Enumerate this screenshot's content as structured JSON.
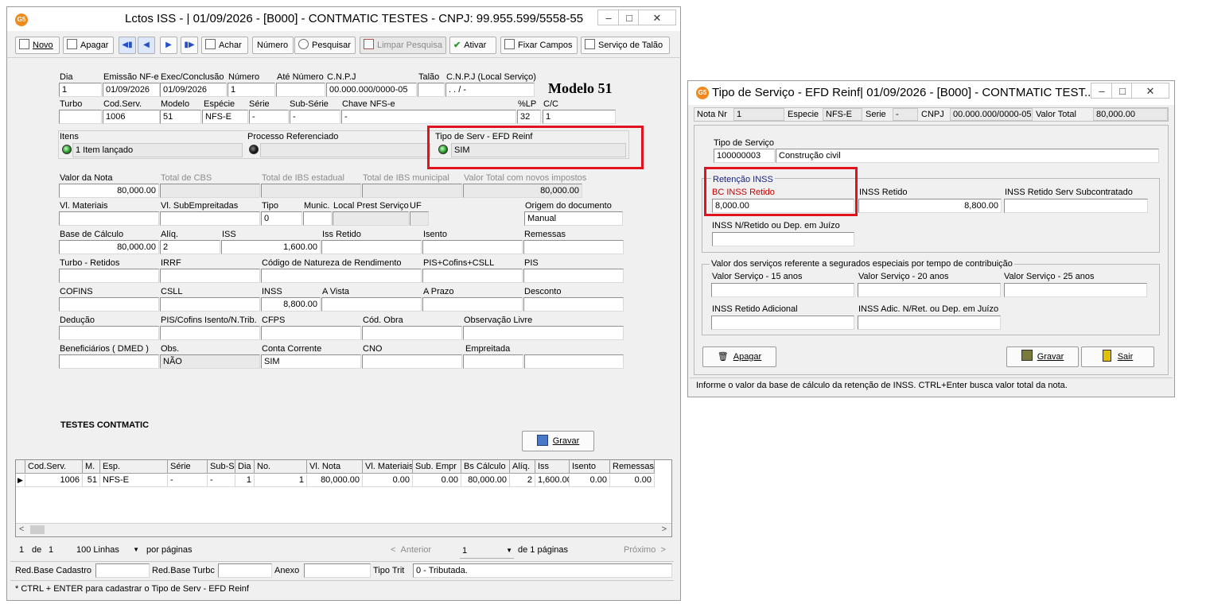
{
  "main": {
    "title": "Lctos ISS - |  01/09/2026 - [B000] - CONTMATIC  TESTES - CNPJ: 99.955.599/5558-55",
    "app_icon": "G5",
    "toolbar": {
      "novo": "Novo",
      "apagar": "Apagar",
      "achar": "Achar",
      "numero": "Número",
      "pesquisar": "Pesquisar",
      "limpar": "Limpar Pesquisa",
      "ativar": "Ativar",
      "fixar": "Fixar Campos",
      "servico": "Serviço de Talão"
    },
    "modelo": "Modelo 51",
    "labels": {
      "dia": "Dia",
      "emissao": "Emissão NF-e",
      "exec": "Exec/Conclusão",
      "numero": "Número",
      "ate_numero": "Até Número",
      "cnpj": "C.N.P.J",
      "talao": "Talão",
      "cnpj_local": "C.N.P.J (Local Serviço)",
      "turbo": "Turbo",
      "cod_serv": "Cod.Serv.",
      "modelo": "Modelo",
      "especie": "Espécie",
      "serie": "Série",
      "sub_serie": "Sub-Série",
      "chave": "Chave NFS-e",
      "lp": "%LP",
      "cc": "C/C",
      "itens": "Itens",
      "processo": "Processo Referenciado",
      "tipo_serv": "Tipo de Serv - EFD Reinf",
      "valor_nota": "Valor da Nota",
      "total_cbs": "Total de CBS",
      "total_ibs_est": "Total de IBS estadual",
      "total_ibs_mun": "Total de IBS municipal",
      "valor_total_novos": "Valor Total com novos impostos",
      "vl_materiais": "Vl. Materiais",
      "vl_sub": "Vl. SubEmpreitadas",
      "tipo": "Tipo",
      "munic": "Munic.",
      "local_prest": "Local Prest Serviço",
      "uf": "UF",
      "origem": "Origem do documento",
      "base_calc": "Base de Cálculo",
      "aliq": "Alíq.",
      "iss": "ISS",
      "iss_retido": "Iss Retido",
      "isento": "Isento",
      "remessas": "Remessas",
      "turbo_ret": "Turbo - Retidos",
      "irrf": "IRRF",
      "cod_nat": "Código de Natureza de Rendimento",
      "pis_cofins_csll": "PIS+Cofins+CSLL",
      "pis": "PIS",
      "cofins": "COFINS",
      "csll": "CSLL",
      "inss": "INSS",
      "a_vista": "A Vista",
      "a_prazo": "A Prazo",
      "desconto": "Desconto",
      "deducao": "Dedução",
      "pis_cofins_isento": "PIS/Cofins Isento/N.Trib.",
      "cfps": "CFPS",
      "cod_obra": "Cód. Obra",
      "obs_livre": "Observação Livre",
      "beneficiarios": "Beneficiários ( DMED )",
      "obs": "Obs.",
      "conta_corrente": "Conta Corrente",
      "cno": "CNO",
      "empreitada": "Empreitada"
    },
    "values": {
      "dia": "1",
      "emissao": "01/09/2026",
      "exec": "01/09/2026",
      "numero": "1",
      "cnpj": "00.000.000/0000-05",
      "cnpj_local": ".   .   /   -",
      "cod_serv": "1006",
      "modelo": "51",
      "especie": "NFS-E",
      "serie": "-",
      "sub_serie": "-",
      "chave": "-",
      "lp": "32",
      "cc": "1",
      "itens": "1 Item lançado",
      "tipo_serv": "SIM",
      "valor_nota": "80,000.00",
      "valor_total_novos": "80,000.00",
      "tipo": "0",
      "origem": "Manual",
      "base_calc": "80,000.00",
      "aliq": "2",
      "iss": "1,600.00",
      "inss": "8,800.00",
      "obs": "NÃO",
      "conta_corrente": "SIM"
    },
    "company": "TESTES CONTMATIC",
    "gravar": "Gravar",
    "grid": {
      "headers": [
        "Cod.Serv.",
        "M.",
        "Esp.",
        "Série",
        "Sub-S",
        "Dia",
        "No.",
        "Vl. Nota",
        "Vl. Materiais",
        "Sub. Empr",
        "Bs Cálculo",
        "Alíq.",
        "Iss",
        "Isento",
        "Remessas"
      ],
      "row": [
        "1006",
        "51",
        "NFS-E",
        "-",
        "-",
        "1",
        "1",
        "80,000.00",
        "0.00",
        "0.00",
        "80,000.00",
        "2",
        "1,600.00",
        "0.00",
        "0.00"
      ]
    },
    "pager": {
      "page": "1",
      "de": "de",
      "total": "1",
      "per_page": "100 Linhas",
      "por_paginas": "por páginas",
      "anterior": "Anterior",
      "current": "1",
      "de_paginas": "de 1 páginas",
      "proximo": "Próximo"
    },
    "bottom": {
      "red_base_cad": "Red.Base Cadastro",
      "red_base_turbo": "Red.Base Turbc",
      "anexo": "Anexo",
      "tipo_trib": "Tipo Trit",
      "tipo_trib_value": "0 - Tributada."
    },
    "hint": "* CTRL + ENTER para  cadastrar o Tipo de Serv - EFD Reinf"
  },
  "dialog": {
    "title": "Tipo de Serviço - EFD Reinf|  01/09/2026 - [B000] - CONTMATIC  TEST...",
    "app_icon": "G5",
    "header": {
      "nota_nr_label": "Nota Nr",
      "nota_nr": "1",
      "especie_label": "Especie",
      "especie": "NFS-E",
      "serie_label": "Serie",
      "serie": "-",
      "cnpj_label": "CNPJ",
      "cnpj": "00.000.000/0000-05",
      "valor_total_label": "Valor Total",
      "valor_total": "80,000.00"
    },
    "tipo_servico_label": "Tipo de Serviço",
    "tipo_servico_code": "100000003",
    "tipo_servico_desc": "Construção civil",
    "retencao": {
      "title": "Retenção INSS",
      "bc_label": "BC INSS Retido",
      "bc_value": "8,000.00",
      "inss_retido_label": "INSS Retido",
      "inss_retido_value": "8,800.00",
      "subcontratado_label": "INSS Retido Serv Subcontratado",
      "nretido_label": "INSS N/Retido ou Dep. em Juízo"
    },
    "especiais": {
      "title": "Valor dos serviços referente a segurados especiais por tempo de contribuição",
      "v15": "Valor Serviço - 15 anos",
      "v20": "Valor Serviço - 20 anos",
      "v25": "Valor Serviço - 25 anos",
      "adicional": "INSS Retido Adicional",
      "adic_nret": "INSS Adic. N/Ret. ou Dep. em Juízo"
    },
    "buttons": {
      "apagar": "Apagar",
      "gravar": "Gravar",
      "sair": "Sair"
    },
    "status": "Informe o valor da base de cálculo da retenção de INSS. CTRL+Enter busca valor total da nota."
  },
  "colors": {
    "highlight": "#e0141e",
    "retencao_title": "#1a237e",
    "bc_label": "#c00000"
  }
}
